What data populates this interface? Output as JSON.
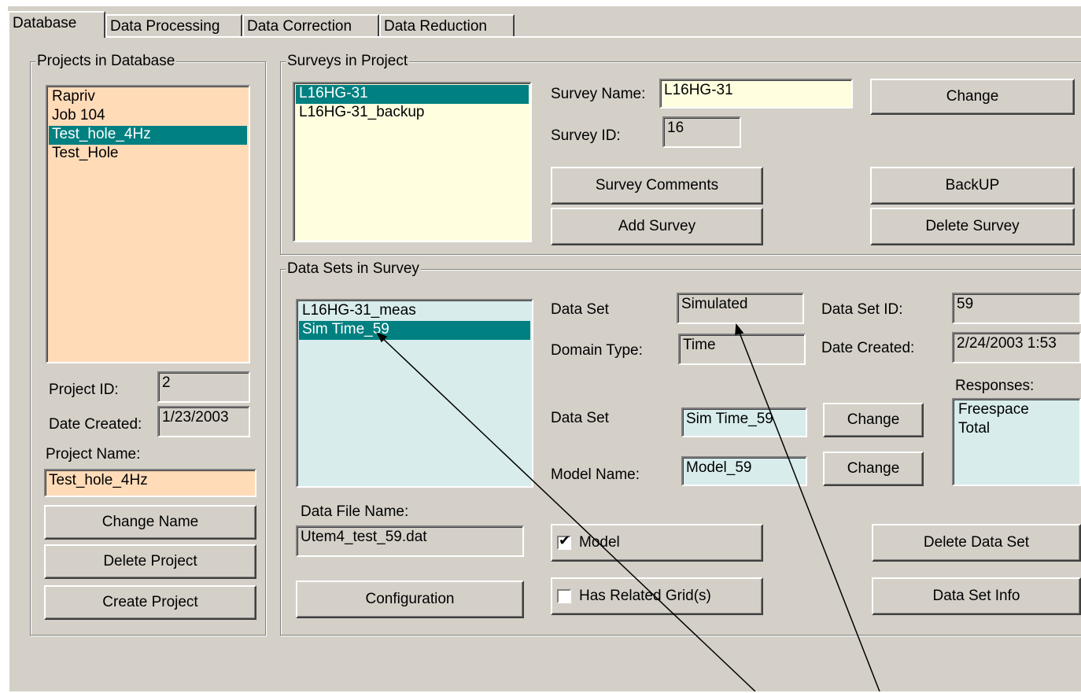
{
  "tabs": [
    "Database",
    "Data Processing",
    "Data Correction",
    "Data Reduction"
  ],
  "projects": {
    "legend": "Projects in Database",
    "items": [
      {
        "label": "Rapriv",
        "selected": false
      },
      {
        "label": "Job 104",
        "selected": false
      },
      {
        "label": "Test_hole_4Hz",
        "selected": true
      },
      {
        "label": "Test_Hole",
        "selected": false
      }
    ],
    "id_label": "Project ID:",
    "id_value": "2",
    "date_label": "Date Created:",
    "date_value": "1/23/2003",
    "name_label": "Project Name:",
    "name_value": "Test_hole_4Hz",
    "change_name": "Change Name",
    "delete_project": "Delete Project",
    "create_project": "Create Project"
  },
  "surveys": {
    "legend": "Surveys in Project",
    "items": [
      {
        "label": "L16HG-31",
        "selected": true
      },
      {
        "label": "L16HG-31_backup",
        "selected": false
      }
    ],
    "name_label": "Survey Name:",
    "name_value": "L16HG-31",
    "id_label": "Survey ID:",
    "id_value": "16",
    "change": "Change",
    "comments": "Survey Comments",
    "add": "Add Survey",
    "backup": "BackUP",
    "delete": "Delete Survey"
  },
  "datasets": {
    "legend": "Data Sets in Survey",
    "items": [
      {
        "label": "L16HG-31_meas",
        "selected": false
      },
      {
        "label": "Sim Time_59",
        "selected": true
      }
    ],
    "dataset_label": "Data Set",
    "dataset_value": "Simulated",
    "domain_label": "Domain Type:",
    "domain_value": "Time",
    "id_label": "Data Set ID:",
    "id_value": "59",
    "date_label": "Date Created:",
    "date_value": "2/24/2003 1:53",
    "responses_label": "Responses:",
    "responses": [
      "Freespace",
      "Total"
    ],
    "dataset_name_label": "Data Set",
    "dataset_name_value": "Sim Time_59",
    "model_label": "Model Name:",
    "model_value": "Model_59",
    "change1": "Change",
    "change2": "Change",
    "file_label": "Data File Name:",
    "file_value": "Utem4_test_59.dat",
    "model_check_label": "Model",
    "model_checked": true,
    "grid_check_label": "Has Related Grid(s)",
    "grid_checked": false,
    "configuration": "Configuration",
    "delete": "Delete Data Set",
    "info": "Data Set Info"
  },
  "colors": {
    "face": "#d4d0c8",
    "selection": "#008080",
    "project_list_bg": "#ffdbb8",
    "survey_list_bg": "#ffffe0",
    "dataset_list_bg": "#d8ecec"
  }
}
